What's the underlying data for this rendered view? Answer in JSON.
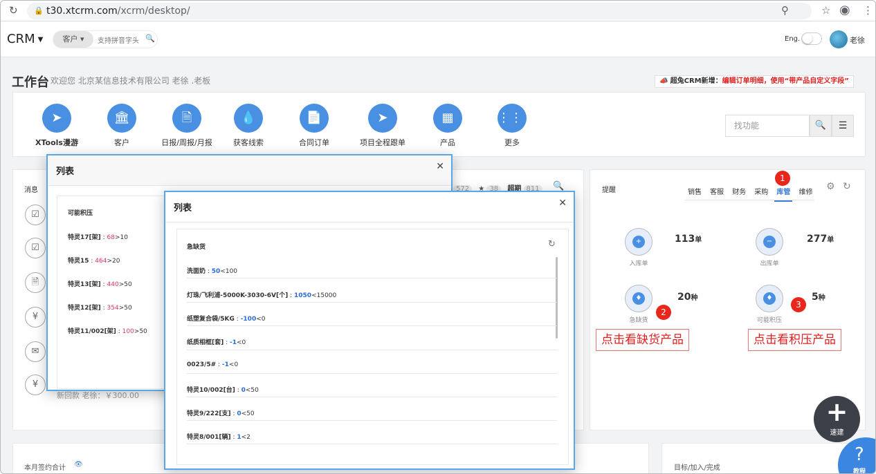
{
  "browser": {
    "url_host": "t30.xtcrm.com",
    "url_path": "/xcrm/desktop/"
  },
  "topnav": {
    "brand": "CRM",
    "scope": "客户",
    "search_placeholder": "支持拼音字头",
    "lang": "Eng.",
    "username": "老徐"
  },
  "workbench": {
    "title": "工作台",
    "welcome": "欢迎您 北京某信息技术有限公司 老徐 .老板",
    "notice_prefix": "超兔CRM新增：",
    "notice_text": "编辑订单明细，使用“带产品自定义字段”"
  },
  "quick": {
    "items": [
      {
        "label": "XTools漫游",
        "icon": "rocket-icon"
      },
      {
        "label": "客户",
        "icon": "bank-icon"
      },
      {
        "label": "日报/周报/月报",
        "icon": "document-icon"
      },
      {
        "label": "获客线索",
        "icon": "drop-icon"
      },
      {
        "label": "合同订单",
        "icon": "file-icon"
      },
      {
        "label": "项目全程跟单",
        "icon": "rocket-icon"
      },
      {
        "label": "产品",
        "icon": "grid-icon"
      },
      {
        "label": "更多",
        "icon": "dots-icon"
      }
    ],
    "find_placeholder": "找功能"
  },
  "messages": {
    "title": "消息",
    "stat1": "572",
    "stat2": "38",
    "overdue_label": "超期",
    "overdue_count": "811",
    "footer": "新回款 老徐：￥300.00"
  },
  "reminder": {
    "title": "提醒",
    "tabs": [
      "销售",
      "客服",
      "财务",
      "采购",
      "库管",
      "维修"
    ],
    "stats": {
      "inbound": {
        "label": "入库单",
        "value": "113",
        "unit": "单"
      },
      "outbound": {
        "label": "出库单",
        "value": "277",
        "unit": "单"
      },
      "shortage": {
        "label": "急缺货",
        "value": "20",
        "unit": "种"
      },
      "overstock": {
        "label": "可能积压",
        "value": "5",
        "unit": "种"
      }
    },
    "badges": [
      "1",
      "2",
      "3"
    ],
    "callout_shortage": "点击看缺货产品",
    "callout_overstock": "点击看积压产品"
  },
  "bottom": {
    "left_title": "本月签约合计",
    "right_title": "目标/加入/完成"
  },
  "fab": {
    "label": "速建"
  },
  "help": {
    "label": "教程"
  },
  "modal1": {
    "title": "列表",
    "section": "可能积压",
    "rows": [
      {
        "name": "特灵17[架]",
        "value": "68",
        "op": ">",
        "limit": "10"
      },
      {
        "name": "特灵15",
        "value": "464",
        "op": ">",
        "limit": "20"
      },
      {
        "name": "特灵13[架]",
        "value": "440",
        "op": ">",
        "limit": "50"
      },
      {
        "name": "特灵12[架]",
        "value": "354",
        "op": ">",
        "limit": "50"
      },
      {
        "name": "特灵11/002[架]",
        "value": "100",
        "op": ">",
        "limit": "50"
      }
    ]
  },
  "modal2": {
    "title": "列表",
    "section": "急缺货",
    "rows": [
      {
        "name": "洗面奶",
        "value": "50",
        "op": "<",
        "limit": "100"
      },
      {
        "name": "灯珠/飞利浦-5000K-3030-6V[个]",
        "value": "1050",
        "op": "<",
        "limit": "15000"
      },
      {
        "name": "纸塑复合袋/5KG",
        "value": "-100",
        "op": "<",
        "limit": "0"
      },
      {
        "name": "纸质相框[套]",
        "value": "-1",
        "op": "<",
        "limit": "0"
      },
      {
        "name": "0023/5#",
        "value": "-1",
        "op": "<",
        "limit": "0"
      },
      {
        "name": "特灵10/002[台]",
        "value": "0",
        "op": "<",
        "limit": "50"
      },
      {
        "name": "特灵9/222[支]",
        "value": "0",
        "op": "<",
        "limit": "50"
      },
      {
        "name": "特灵8/001[辆]",
        "value": "1",
        "op": "<",
        "limit": "2"
      }
    ]
  }
}
